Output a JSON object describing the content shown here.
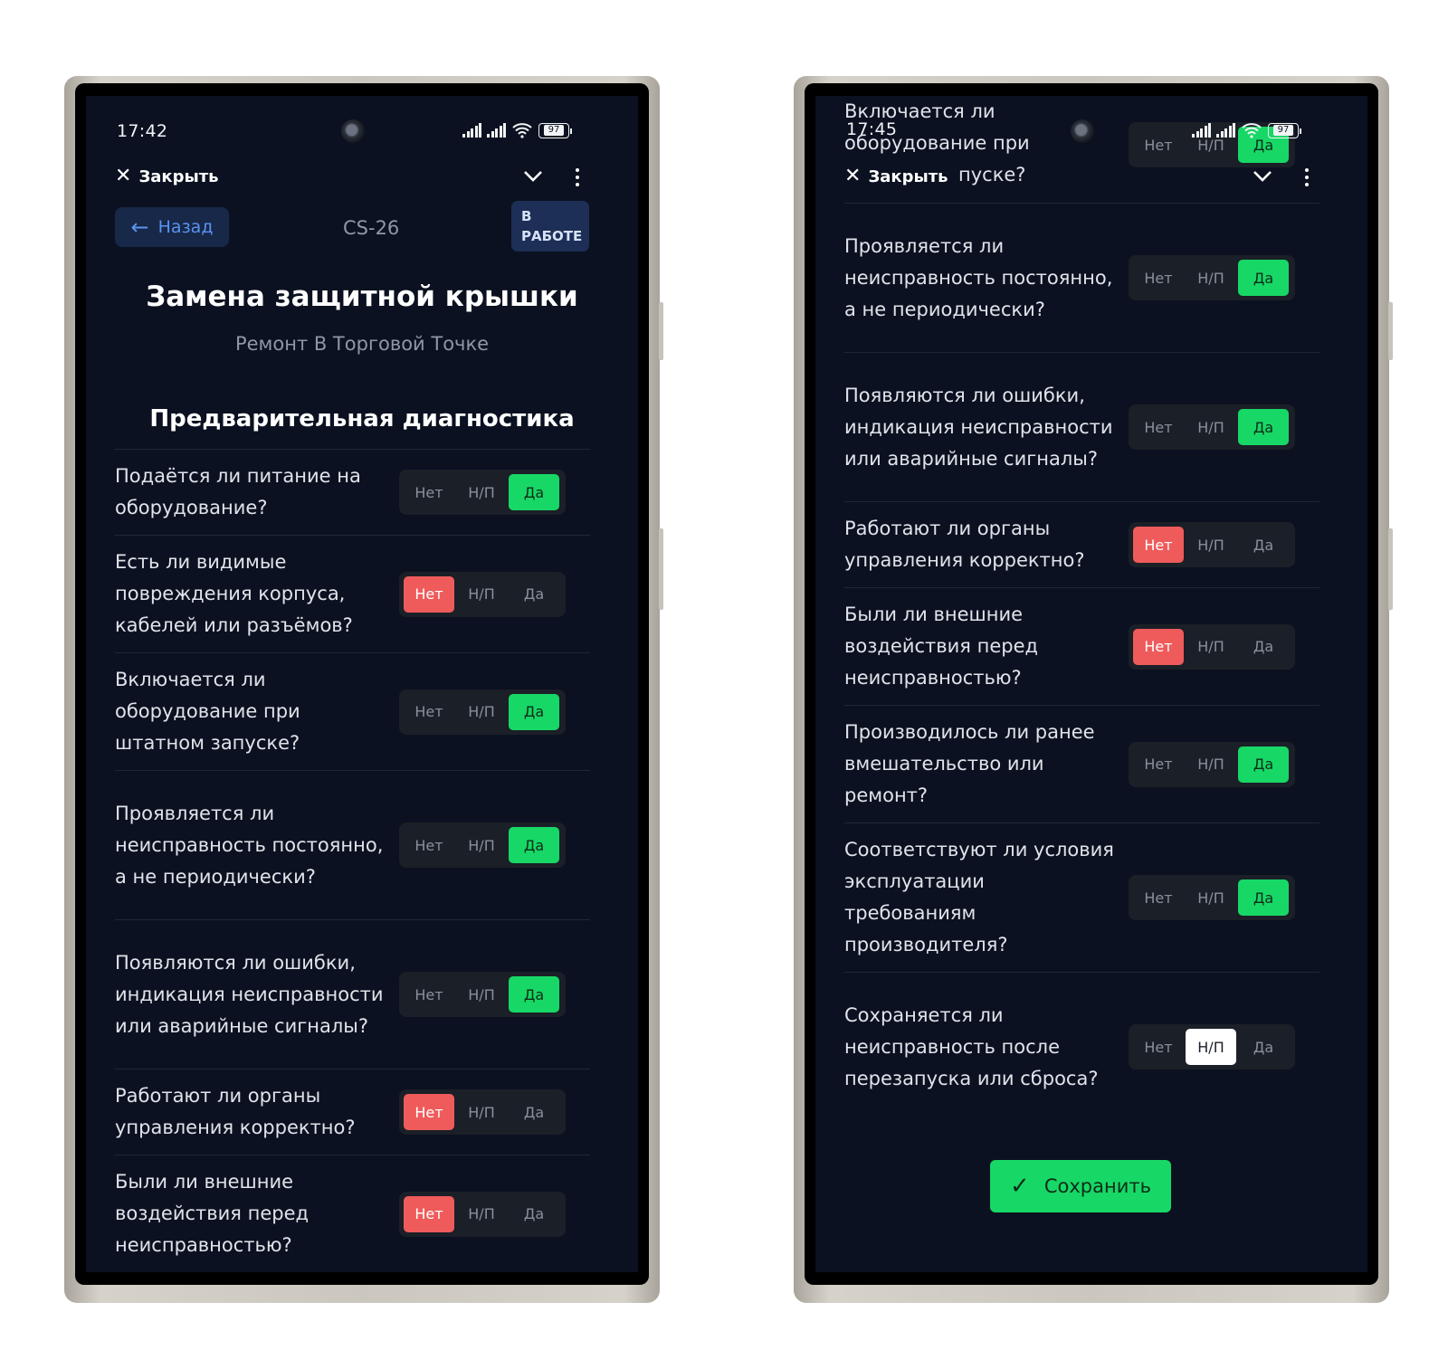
{
  "left": {
    "status_time": "17:42",
    "battery": "97",
    "close_label": "Закрыть",
    "back_label": "Назад",
    "code": "CS-26",
    "status_line1": "В",
    "status_line2": "РАБОТЕ",
    "title": "Замена защитной крышки",
    "subtitle": "Ремонт В Торговой Точке",
    "section": "Предварительная диагностика",
    "questions": [
      {
        "text": "Подаётся ли питание на оборудование?",
        "answer": "yes"
      },
      {
        "text": "Есть ли видимые повреждения корпуса, кабелей или разъёмов?",
        "answer": "no"
      },
      {
        "text": "Включается ли оборудование при штатном запуске?",
        "answer": "yes"
      },
      {
        "text": "Проявляется ли неисправность постоянно, а не периодически?",
        "answer": "yes"
      },
      {
        "text": "Появляются ли ошибки, индикация неисправности или аварийные сигналы?",
        "answer": "yes"
      },
      {
        "text": "Работают ли органы управления корректно?",
        "answer": "no"
      },
      {
        "text": "Были ли внешние воздействия перед неисправностью?",
        "answer": "no"
      }
    ]
  },
  "right": {
    "status_time": "17:45",
    "battery": "97",
    "close_label": "Закрыть",
    "partial_question_l1": "Включается ли",
    "partial_question_l2": "оборудование при",
    "partial_question_l3": "пуске?",
    "questions": [
      {
        "text": "Проявляется ли неисправность постоянно, а не периодически?",
        "answer": "yes"
      },
      {
        "text": "Появляются ли ошибки, индикация неисправности или аварийные сигналы?",
        "answer": "yes"
      },
      {
        "text": "Работают ли органы управления корректно?",
        "answer": "no"
      },
      {
        "text": "Были ли внешние воздействия перед неисправностью?",
        "answer": "no"
      },
      {
        "text": "Производилось ли ранее вмешательство или ремонт?",
        "answer": "yes"
      },
      {
        "text": "Соответствуют ли условия эксплуатации требованиям производителя?",
        "answer": "yes"
      },
      {
        "text": "Сохраняется ли неисправность после перезапуска или сброса?",
        "answer": "na"
      }
    ],
    "save_label": "Сохранить"
  },
  "options": {
    "no": "Нет",
    "na": "Н/П",
    "yes": "Да"
  },
  "colors": {
    "screen_bg": "#0b1120",
    "yes": "#17d866",
    "no": "#ef5b5b",
    "na": "#ffffff",
    "accent": "#5a93f0"
  }
}
